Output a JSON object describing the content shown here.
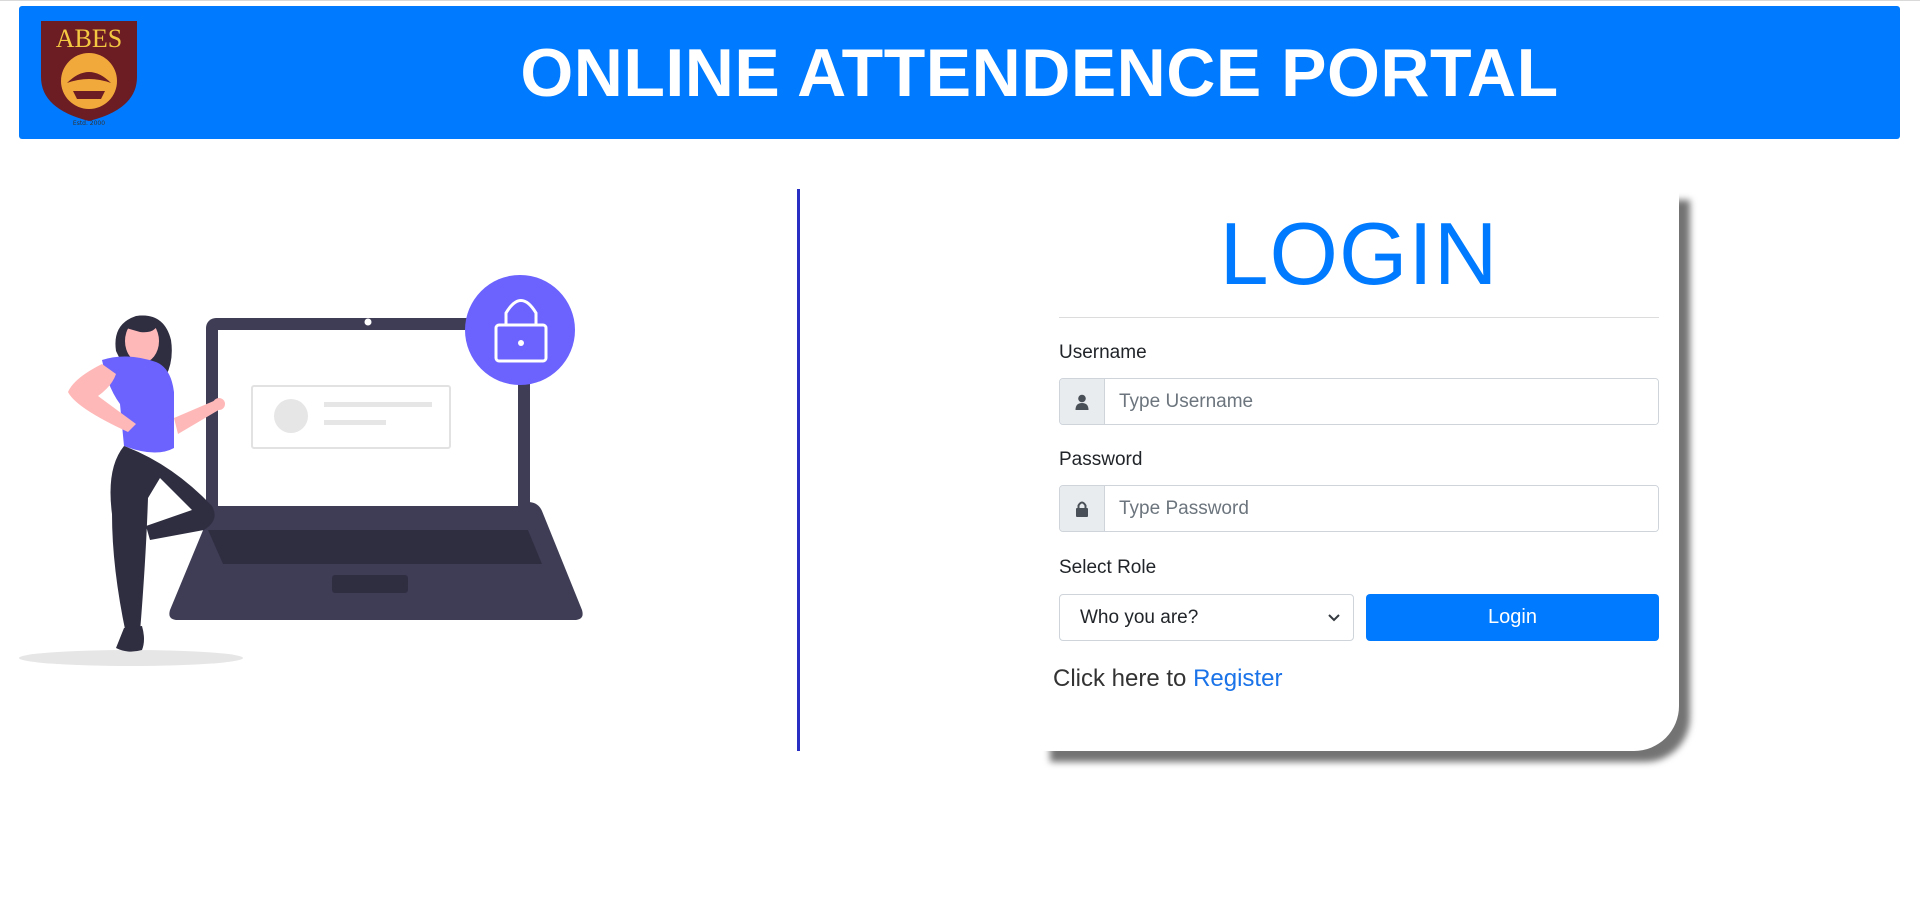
{
  "header": {
    "logo_text": "ABES",
    "logo_subtext": "Estd. 2000",
    "title": "ONLINE ATTENDENCE PORTAL"
  },
  "login_card": {
    "title": "LOGIN",
    "username_label": "Username",
    "username_placeholder": "Type Username",
    "password_label": "Password",
    "password_placeholder": "Type Password",
    "role_label": "Select Role",
    "role_selected": "Who you are?",
    "login_button": "Login",
    "register_prefix": "Click here to",
    "register_link": "Register"
  },
  "colors": {
    "brand_blue": "#007bff",
    "divider": "#2a2fc4",
    "illustration_purple": "#6c63ff",
    "illustration_dark": "#3f3d56"
  },
  "icons": [
    "user-icon",
    "lock-icon",
    "chevron-down-icon"
  ]
}
